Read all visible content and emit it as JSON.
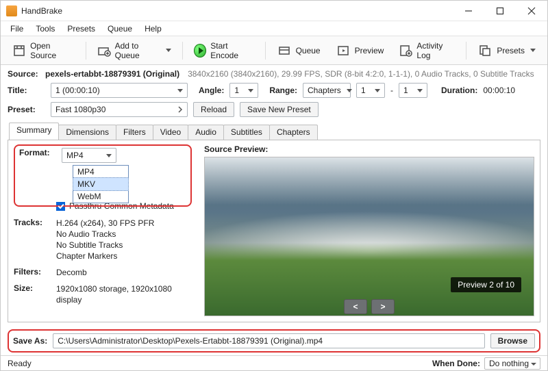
{
  "titlebar": {
    "title": "HandBrake"
  },
  "menubar": [
    "File",
    "Tools",
    "Presets",
    "Queue",
    "Help"
  ],
  "toolbar": {
    "open": "Open Source",
    "add_queue": "Add to Queue",
    "start": "Start Encode",
    "queue": "Queue",
    "preview": "Preview",
    "activity": "Activity Log",
    "presets": "Presets"
  },
  "source": {
    "label": "Source:",
    "name": "pexels-ertabbt-18879391 (Original)",
    "meta": "3840x2160 (3840x2160), 29.99 FPS, SDR (8-bit 4:2:0, 1-1-1), 0 Audio Tracks, 0 Subtitle Tracks"
  },
  "title_row": {
    "label": "Title:",
    "value": "1  (00:00:10)",
    "angle_label": "Angle:",
    "angle_value": "1",
    "range_label": "Range:",
    "range_type": "Chapters",
    "range_from": "1",
    "range_sep": "-",
    "range_to": "1",
    "duration_label": "Duration:",
    "duration_value": "00:00:10"
  },
  "preset_row": {
    "label": "Preset:",
    "value": "Fast 1080p30",
    "reload": "Reload",
    "save_new": "Save New Preset"
  },
  "tabs": [
    "Summary",
    "Dimensions",
    "Filters",
    "Video",
    "Audio",
    "Subtitles",
    "Chapters"
  ],
  "summary": {
    "format": {
      "label": "Format:",
      "selected": "MP4",
      "options": [
        "MP4",
        "MKV",
        "WebM"
      ],
      "chk_passthru": "Passthru Common Metadata"
    },
    "tracks": {
      "label": "Tracks:",
      "lines": [
        "H.264 (x264), 30 FPS PFR",
        "No Audio Tracks",
        "No Subtitle Tracks",
        "Chapter Markers"
      ]
    },
    "filters": {
      "label": "Filters:",
      "value": "Decomb"
    },
    "size": {
      "label": "Size:",
      "value": "1920x1080 storage, 1920x1080 display"
    },
    "preview_title": "Source Preview:",
    "preview_badge": "Preview 2 of 10",
    "nav_prev": "<",
    "nav_next": ">"
  },
  "save_as": {
    "label": "Save As:",
    "path": "C:\\Users\\Administrator\\Desktop\\Pexels-Ertabbt-18879391 (Original).mp4",
    "browse": "Browse"
  },
  "status": {
    "ready": "Ready",
    "when_done_label": "When Done:",
    "when_done_value": "Do nothing"
  }
}
